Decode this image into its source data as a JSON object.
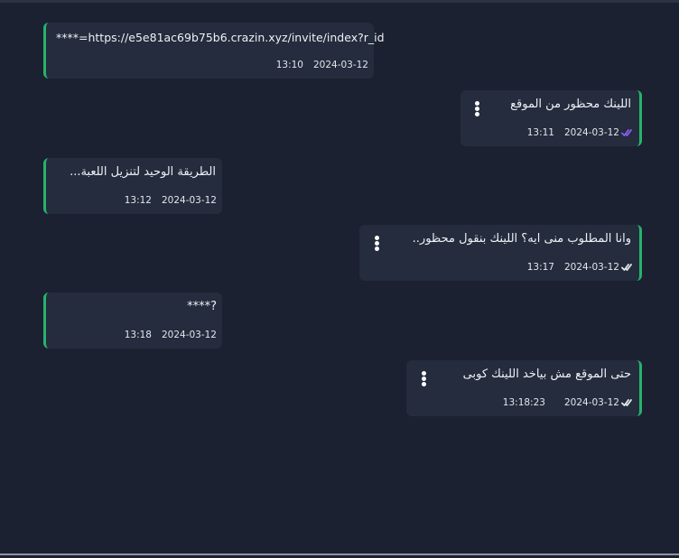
{
  "messages": [
    {
      "direction": "incoming",
      "text": "****=https://e5e81ac69b75b6.crazin.xyz/invite/index?r_id",
      "time": "13:10",
      "date": "2024-03-12"
    },
    {
      "direction": "outgoing",
      "text": "اللينك محظور من الموقع",
      "time": "13:11",
      "date": "2024-03-12",
      "status": "read",
      "status_color": "#8b5cf6"
    },
    {
      "direction": "incoming",
      "text": "الطريقة الوحيد لتنزيل اللعبة...",
      "time": "13:12",
      "date": "2024-03-12"
    },
    {
      "direction": "outgoing",
      "text": "وانا المطلوب منى ايه؟ اللينك بنقول محظور..",
      "time": "13:17",
      "date": "2024-03-12",
      "status": "delivered",
      "status_color": "#e6e9ef"
    },
    {
      "direction": "incoming",
      "text": "****?",
      "time": "13:18",
      "date": "2024-03-12"
    },
    {
      "direction": "outgoing",
      "text": "حتى الموقع مش بياخد اللينك كوبى",
      "time": "13:18:23",
      "date": "2024-03-12",
      "status": "delivered",
      "status_color": "#e6e9ef"
    }
  ],
  "colors": {
    "background": "#1b2130",
    "bubble": "#242c3d",
    "accent": "#26b36b"
  },
  "icons": {
    "menu": "kebab-menu-icon",
    "read": "double-check-icon"
  }
}
